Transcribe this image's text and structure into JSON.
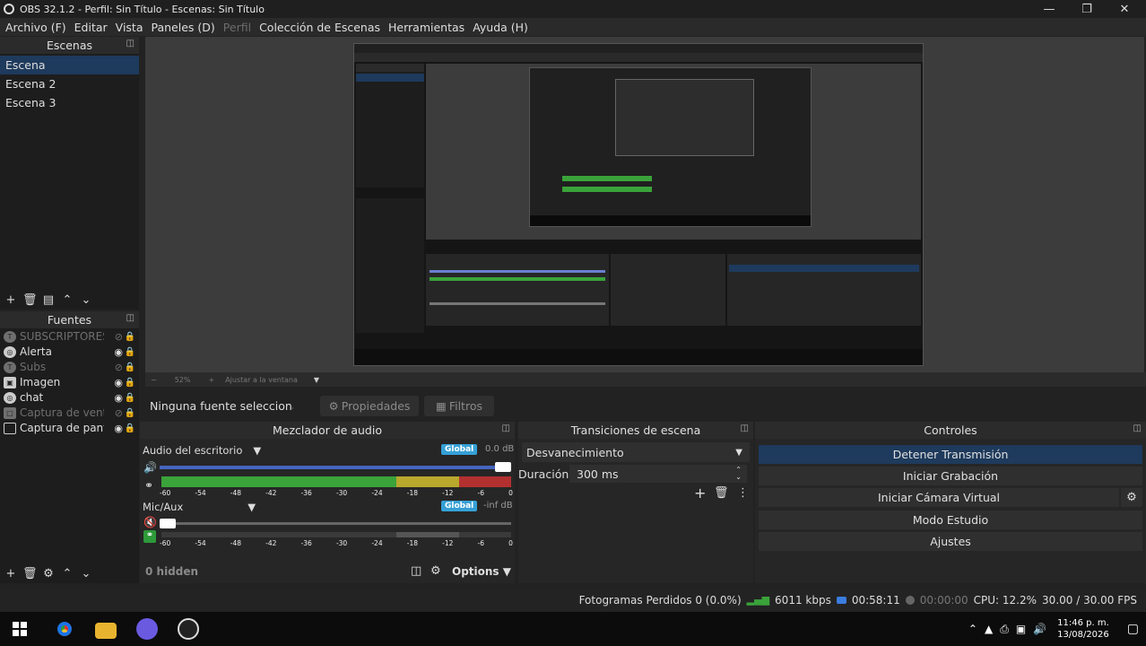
{
  "window": {
    "title": "OBS 32.1.2 - Perfil: Sin Título - Escenas: Sin Título",
    "minimize_icon": "minimize-icon",
    "restore_icon": "restore-icon",
    "close_icon": "close-icon"
  },
  "menu": [
    "Archivo (F)",
    "Editar",
    "Vista",
    "Paneles (D)",
    "Perfil",
    "Colección de Escenas",
    "Herramientas",
    "Ayuda (H)"
  ],
  "scenes": {
    "title": "Escenas",
    "items": [
      "Escena",
      "Escena 2",
      "Escena 3"
    ],
    "selected": "Escena"
  },
  "sources": {
    "title": "Fuentes",
    "items": [
      {
        "name": "SUBSCRIPTORES",
        "visible": false
      },
      {
        "name": "Alerta",
        "visible": true
      },
      {
        "name": "Subs",
        "visible": false
      },
      {
        "name": "Imagen",
        "visible": true
      },
      {
        "name": "chat",
        "visible": true
      },
      {
        "name": "Captura de venta",
        "visible": false
      },
      {
        "name": "Captura de panta",
        "visible": true
      }
    ]
  },
  "preview_bar": {
    "zoom": "52%",
    "fit_label": "Ajustar a la ventana"
  },
  "source_bar": {
    "no_selection": "Ninguna fuente seleccionada",
    "properties": "Propiedades",
    "filters": "Filtros"
  },
  "mixer": {
    "title": "Mezclador de audio",
    "channels": [
      {
        "name": "Audio del escritorio",
        "badge": "Global",
        "db": "0.0 dB",
        "volume": 1.0,
        "level": 1.0
      },
      {
        "name": "Mic/Aux",
        "badge": "Global",
        "db": "-inf dB",
        "volume": 0.0,
        "level": 0.0
      }
    ],
    "ticks": [
      "-60",
      "-54",
      "-48",
      "-42",
      "-36",
      "-30",
      "-24",
      "-18",
      "-12",
      "-6",
      "0"
    ],
    "hidden": "0 hidden",
    "options": "Options"
  },
  "transitions": {
    "title": "Transiciones de escena",
    "selected": "Desvanecimiento",
    "duration_label": "Duración",
    "duration_value": "300 ms"
  },
  "controls": {
    "title": "Controles",
    "buttons": [
      "Detener Transmisión",
      "Iniciar Grabación",
      "Iniciar Cámara Virtual",
      "Modo Estudio",
      "Ajustes"
    ]
  },
  "status": {
    "dropped": "Fotogramas Perdidos 0 (0.0%)",
    "bitrate": "6011 kbps",
    "stream_time": "00:58:11",
    "rec_time": "00:00:00",
    "cpu": "CPU: 12.2%",
    "fps": "30.00 / 30.00 FPS"
  },
  "taskbar": {
    "time": "11:46 p. m.",
    "date": "13/08/2026"
  },
  "colors": {
    "accent": "#1e3a5c",
    "meter_green": "#3aa33a",
    "meter_yellow": "#b8a82c",
    "meter_red": "#b23030",
    "global_badge": "#35a0d6"
  }
}
